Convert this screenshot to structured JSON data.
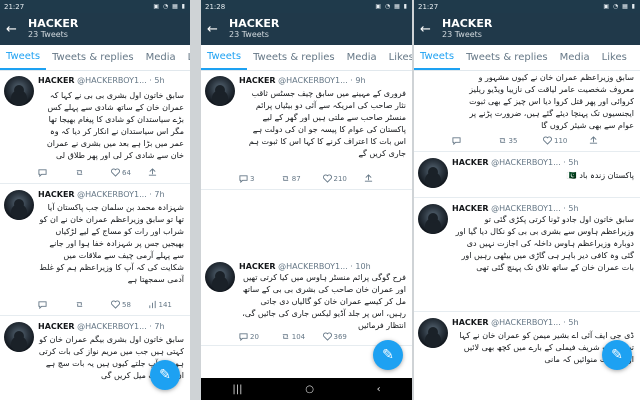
{
  "panels": [
    {
      "status_time": "21:27",
      "status_icons": "▣ ◔ ▦ ▮",
      "header": {
        "title": "HACKER",
        "subtitle": "23 Tweets"
      },
      "tabs": [
        "Tweets",
        "Tweets & replies",
        "Media",
        "Likes"
      ],
      "tweets": [
        {
          "name": "HACKER",
          "handle": "@HACKERBOY1...",
          "time": "· 5h",
          "text": "سابق خاتون اول بشری بی بی نے کہا کہ عمران خان کے ساتھ شادی سے پہلے کس بڑے سیاستدان کو شادی کا پیغام بھیجا تھا مگر اس سیاستدان نے انکار کر دیا کہ وہ عمر میں بڑا ہے بعد میں بشری نے عمران خان سے شادی کر لی اور پھر طلاق لی",
          "counts": [
            "",
            "",
            "64",
            ""
          ]
        },
        {
          "name": "HACKER",
          "handle": "@HACKERBOY1...",
          "time": "· 7h",
          "text": "شہزادہ محمد بن سلمان جب پاکستان آیا تھا تو سابق وزیراعظم عمران خان نے ان کو شراب اور رات کو مساج کے لیے لڑکیاں بھیجیں جس پر شہزادہ خفا ہوا اور جانے سے پہلے آرمی چیف سے ملاقات میں شکایت کی کہ آپ کا وزیراعظم ہم کو غلط آدمی سمجھتا ہے",
          "counts": [
            "",
            "",
            "58",
            "141"
          ]
        },
        {
          "name": "HACKER",
          "handle": "@HACKERBOY1...",
          "time": "· 7h",
          "text": "سابق خاتون اول بشری بیگم عمران خان کو کہتی ہیں جب میں مریم نواز کی بات کرتی ہوں تو آپ جلتے کیوں ہیں یہ بات سچ ہے ان کو بلیک میل کریں گی",
          "counts": [
            "",
            "",
            "",
            ""
          ]
        }
      ]
    },
    {
      "status_time": "21:28",
      "status_icons": "▣ ◔ ▦ ▮",
      "header": {
        "title": "HACKER",
        "subtitle": "23 Tweets"
      },
      "tabs": [
        "Tweets",
        "Tweets & replies",
        "Media",
        "Likes"
      ],
      "tweets": [
        {
          "name": "HACKER",
          "handle": "@HACKERBOY1...",
          "time": "· 9h",
          "text": "فروری کے مہینے میں سابق چیف جسٹس ثاقب نثار صاحب کی امریکہ سے آئی دو بیٹیاں پرائم منسٹر صاحب سے ملتی ہیں اور گھر کے لیے پاکستان کی عوام کا پیسہ جو ان کی دولت ہے اس بات کا اعتراف کرنے کا کہا اس کا ثبوت ہم جاری کریں گے",
          "counts": [
            "3",
            "87",
            "210",
            ""
          ]
        },
        {
          "name": "HACKER",
          "handle": "@HACKERBOY1...",
          "time": "· 10h",
          "text": "فرح گوگی پرائم منسٹر ہاوس میں کیا کرتی تھیں اور عمران خان صاحب کی بشری بی بی کے ساتھ مل کر کیسے عمران خان کو گالیاں دی جاتی رہیں، اس پر جلد آڈیو لیکس جاری کی جائیں گی، انتظار فرمائیں",
          "counts": [
            "20",
            "104",
            "369",
            ""
          ]
        }
      ]
    },
    {
      "status_time": "21:27",
      "status_icons": "▣ ◔ ▦ ▮",
      "header": {
        "title": "HACKER",
        "subtitle": "23 Tweets"
      },
      "tabs": [
        "Tweets",
        "Tweets & replies",
        "Media",
        "Likes"
      ],
      "tweets": [
        {
          "name": "",
          "handle": "",
          "time": "",
          "text": "سابق وزیراعظم عمران خان نے کیوں مشہور و معروف شخصیت عامر لیاقت کی نازیبا ویڈیو ریلیز کروائی اور پھر قتل کروا دیا اس چیز کے بھی ثبوت ایجنسیوں تک پہنچا دیئے گئے ہیں، ضرورت پڑنے پر عوام سے بھی شیئر کروں گا",
          "counts": [
            "",
            "35",
            "110",
            ""
          ]
        },
        {
          "name": "HACKER",
          "handle": "@HACKERBOY1...",
          "time": "· 5h",
          "text": "پاکستان زندہ باد 🇵🇰",
          "counts": [
            "",
            "",
            "",
            ""
          ]
        },
        {
          "name": "HACKER",
          "handle": "@HACKERBOY1...",
          "time": "· 5h",
          "text": "سابق خاتون اول جادو ٹونا کرتی پکڑی گئی تو وزیراعظم ہاوس سے بشری بی بی کو نکال دیا گیا اور دوبارہ وزیراعظم ہاوس داخلہ کی اجازت نہیں دی گئی وہ کافی دیر باہر ہی گاڑی میں بیٹھی رہیں اور بات عمران خان کے ساتھ تلاق تک پہنچ گئی تھی",
          "counts": [
            "",
            "",
            "",
            ""
          ]
        },
        {
          "name": "HACKER",
          "handle": "@HACKERBOY1...",
          "time": "· 5h",
          "text": "ڈی جی ایف آئی اے بشیر میمن کو عمران خان نے کہا تھا کہ آپ شریف فیملی کے بارے میں کچھ بھی لائیں اور یہ بات منوائیں کہ مانی",
          "counts": [
            "",
            "",
            "",
            ""
          ]
        }
      ]
    }
  ]
}
